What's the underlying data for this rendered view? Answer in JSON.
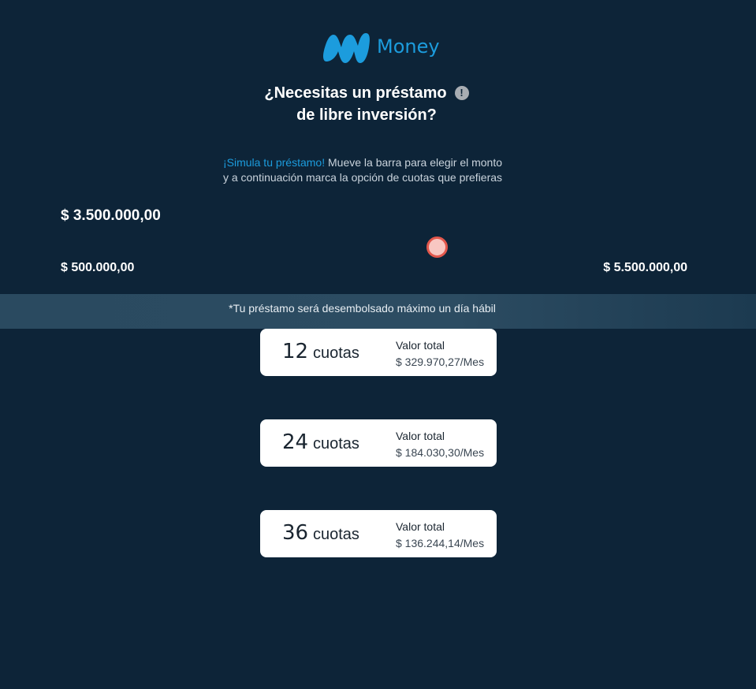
{
  "brand": {
    "name": "Money",
    "accent_color": "#1c9cdd",
    "logo_icon": "movistar-m-icon"
  },
  "header": {
    "title_line1": "¿Necesitas un préstamo",
    "title_line2": "de libre inversión?",
    "info_icon": "info-icon",
    "info_glyph": "!"
  },
  "intro": {
    "highlight": "¡Simula tu préstamo!",
    "line1_rest": " Mueve la barra para elegir el monto",
    "line2": "y a continuación marca la opción de cuotas que prefieras"
  },
  "slider": {
    "current_amount": "$ 3.500.000,00",
    "min_label": "$ 500.000,00",
    "max_label": "$ 5.500.000,00",
    "value_fraction": 0.6
  },
  "notice": "*Tu préstamo será desembolsado máximo un día hábil",
  "options": [
    {
      "count": "12",
      "unit": "cuotas",
      "label": "Valor total",
      "value": "$ 329.970,27/Mes"
    },
    {
      "count": "24",
      "unit": "cuotas",
      "label": "Valor total",
      "value": "$ 184.030,30/Mes"
    },
    {
      "count": "36",
      "unit": "cuotas",
      "label": "Valor total",
      "value": "$ 136.244,14/Mes"
    }
  ],
  "colors": {
    "background": "#0d2438",
    "thumb_fill": "#f8c7c2",
    "thumb_border": "#e2574c"
  }
}
